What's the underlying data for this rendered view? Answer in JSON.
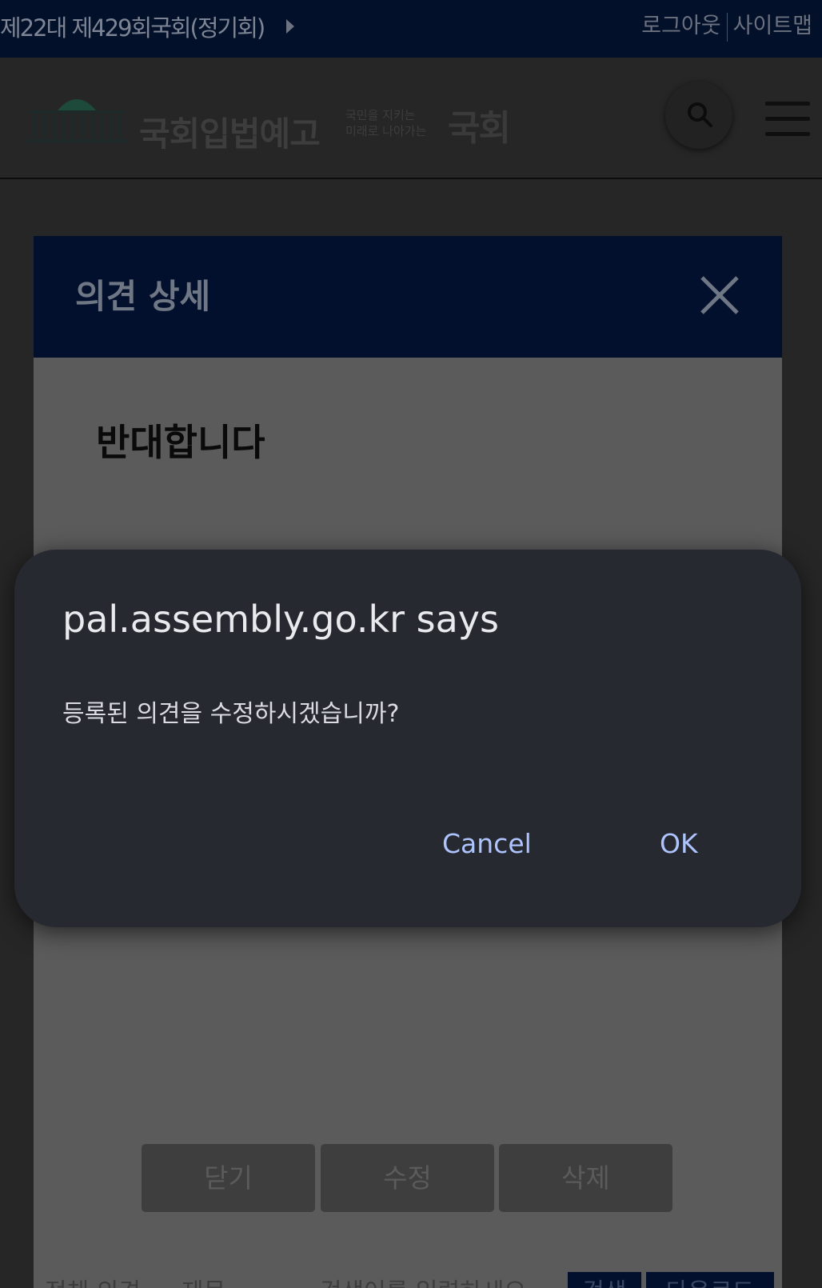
{
  "topbar": {
    "session": "제22대 제429회국회(정기회)",
    "logout": "로그아웃",
    "sitemap": "사이트맵"
  },
  "header": {
    "brand": "국회입법예고",
    "slogan_line1": "국민을 지키는",
    "slogan_line2": "미래로 나아가는",
    "slogan_mark": "국회",
    "search_icon": "search-icon",
    "menu_icon": "hamburger-menu-icon"
  },
  "modal": {
    "title": "의견 상세",
    "close_icon": "close-icon",
    "opinion_text": "반대합니다",
    "buttons": {
      "close": "닫기",
      "edit": "수정",
      "delete": "삭제"
    }
  },
  "background_controls": {
    "filter": "전체 의견",
    "field": "제목",
    "search_placeholder": "검색어를 입력하세요",
    "search_button": "검색",
    "download_button": "다운로드"
  },
  "dialog": {
    "title": "pal.assembly.go.kr says",
    "message": "등록된 의견을 수정하시겠습니까?",
    "cancel": "Cancel",
    "ok": "OK"
  },
  "colors": {
    "topbar": "#03102a",
    "modal_header": "#02102e",
    "dialog_bg": "#272930",
    "dialog_button": "#aec4ff"
  }
}
